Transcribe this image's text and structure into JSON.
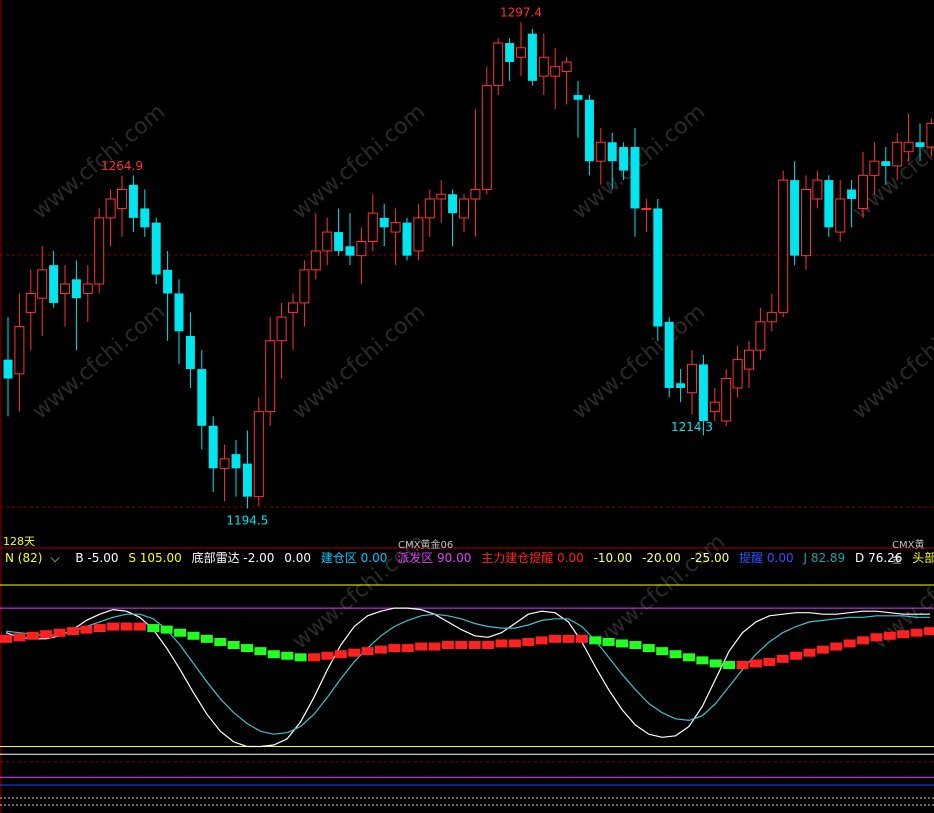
{
  "period_label": "128天",
  "symbol_label": "CMX黄金06",
  "symbol_label_right": "CMX黄金",
  "watermark": "www.cfchi.com",
  "colors": {
    "up": "#ff3333",
    "down": "#00e5ee",
    "dash": "#8b0000",
    "yellow": "#ffff00",
    "magenta": "#e040fb",
    "white": "#ffffff",
    "cyan": "#40c0d0",
    "blue": "#2040ff"
  },
  "indicator_bar": {
    "n": "N (82)",
    "n_arrow": "⌵",
    "b": "B -5.00",
    "s": "S 105.00",
    "bottom_radar": "底部雷达 -2.00",
    "zero": "0.00",
    "build_zone": "建仓区 0.00",
    "distribute_zone": "派发区 90.00",
    "main_alert": "主力建仓提醒 0.00",
    "m10": "-10.00",
    "m20": "-20.00",
    "m25": "-25.00",
    "alert": "提醒 0.00",
    "j": "J 82.89",
    "d": "D 76.26",
    "head": "头部线上取款"
  },
  "chart_data": [
    {
      "type": "candlestick",
      "title": "CMX黄金06",
      "price_annotations": [
        {
          "label": "1297.4",
          "type": "high"
        },
        {
          "label": "1264.9",
          "type": "high"
        },
        {
          "label": "1194.5",
          "type": "low"
        },
        {
          "label": "1214.3",
          "type": "low"
        }
      ],
      "price_range": [
        1191,
        1300
      ],
      "candles": [
        {
          "o": 1226.0,
          "h": 1235.0,
          "l": 1214.0,
          "c": 1222.0
        },
        {
          "o": 1223.0,
          "h": 1240.0,
          "l": 1215.0,
          "c": 1233.0
        },
        {
          "o": 1236.0,
          "h": 1245.0,
          "l": 1228.0,
          "c": 1240.0
        },
        {
          "o": 1239.0,
          "h": 1250.0,
          "l": 1231.0,
          "c": 1245.0
        },
        {
          "o": 1246.0,
          "h": 1249.0,
          "l": 1237.0,
          "c": 1238.0
        },
        {
          "o": 1240.0,
          "h": 1246.0,
          "l": 1233.0,
          "c": 1242.0
        },
        {
          "o": 1243.0,
          "h": 1247.0,
          "l": 1228.0,
          "c": 1239.0
        },
        {
          "o": 1240.0,
          "h": 1246.0,
          "l": 1234.0,
          "c": 1242.0
        },
        {
          "o": 1242.0,
          "h": 1258.0,
          "l": 1240.0,
          "c": 1256.0
        },
        {
          "o": 1256.0,
          "h": 1262.0,
          "l": 1250.0,
          "c": 1260.0
        },
        {
          "o": 1258.0,
          "h": 1264.9,
          "l": 1252.0,
          "c": 1262.0
        },
        {
          "o": 1263.0,
          "h": 1265.0,
          "l": 1253.0,
          "c": 1256.0
        },
        {
          "o": 1258.0,
          "h": 1262.0,
          "l": 1252.0,
          "c": 1254.0
        },
        {
          "o": 1255.0,
          "h": 1256.0,
          "l": 1242.0,
          "c": 1244.0
        },
        {
          "o": 1245.0,
          "h": 1249.0,
          "l": 1230.0,
          "c": 1240.0
        },
        {
          "o": 1240.0,
          "h": 1243.0,
          "l": 1225.0,
          "c": 1232.0
        },
        {
          "o": 1231.0,
          "h": 1236.0,
          "l": 1220.0,
          "c": 1224.0
        },
        {
          "o": 1224.0,
          "h": 1228.0,
          "l": 1207.0,
          "c": 1212.0
        },
        {
          "o": 1212.0,
          "h": 1214.0,
          "l": 1198.0,
          "c": 1203.0
        },
        {
          "o": 1203.0,
          "h": 1208.0,
          "l": 1196.0,
          "c": 1205.0
        },
        {
          "o": 1206.0,
          "h": 1209.0,
          "l": 1197.0,
          "c": 1203.0
        },
        {
          "o": 1204.0,
          "h": 1211.0,
          "l": 1194.5,
          "c": 1197.0
        },
        {
          "o": 1197.0,
          "h": 1218.0,
          "l": 1195.0,
          "c": 1215.0
        },
        {
          "o": 1215.0,
          "h": 1235.0,
          "l": 1212.0,
          "c": 1230.0
        },
        {
          "o": 1230.0,
          "h": 1238.0,
          "l": 1222.0,
          "c": 1235.0
        },
        {
          "o": 1236.0,
          "h": 1240.0,
          "l": 1228.0,
          "c": 1238.0
        },
        {
          "o": 1238.0,
          "h": 1247.0,
          "l": 1233.0,
          "c": 1245.0
        },
        {
          "o": 1245.0,
          "h": 1257.0,
          "l": 1243.0,
          "c": 1249.0
        },
        {
          "o": 1249.0,
          "h": 1256.0,
          "l": 1246.0,
          "c": 1253.0
        },
        {
          "o": 1253.0,
          "h": 1258.0,
          "l": 1248.0,
          "c": 1249.0
        },
        {
          "o": 1250.0,
          "h": 1257.0,
          "l": 1246.0,
          "c": 1248.0
        },
        {
          "o": 1248.0,
          "h": 1254.0,
          "l": 1242.0,
          "c": 1251.0
        },
        {
          "o": 1251.0,
          "h": 1261.0,
          "l": 1249.0,
          "c": 1257.0
        },
        {
          "o": 1256.0,
          "h": 1259.0,
          "l": 1250.0,
          "c": 1254.0
        },
        {
          "o": 1253.0,
          "h": 1258.0,
          "l": 1246.0,
          "c": 1255.0
        },
        {
          "o": 1255.0,
          "h": 1256.0,
          "l": 1247.0,
          "c": 1248.0
        },
        {
          "o": 1249.0,
          "h": 1259.0,
          "l": 1247.0,
          "c": 1256.0
        },
        {
          "o": 1256.0,
          "h": 1262.0,
          "l": 1252.0,
          "c": 1260.0
        },
        {
          "o": 1260.0,
          "h": 1264.0,
          "l": 1255.0,
          "c": 1261.0
        },
        {
          "o": 1261.0,
          "h": 1262.0,
          "l": 1250.0,
          "c": 1257.0
        },
        {
          "o": 1256.0,
          "h": 1261.0,
          "l": 1253.0,
          "c": 1260.0
        },
        {
          "o": 1260.0,
          "h": 1279.0,
          "l": 1252.0,
          "c": 1262.0
        },
        {
          "o": 1262.0,
          "h": 1288.0,
          "l": 1261.0,
          "c": 1284.0
        },
        {
          "o": 1284.0,
          "h": 1294.0,
          "l": 1282.0,
          "c": 1293.0
        },
        {
          "o": 1293.0,
          "h": 1294.0,
          "l": 1285.0,
          "c": 1289.0
        },
        {
          "o": 1290.0,
          "h": 1297.4,
          "l": 1286.0,
          "c": 1292.0
        },
        {
          "o": 1295.0,
          "h": 1296.0,
          "l": 1284.0,
          "c": 1285.0
        },
        {
          "o": 1286.0,
          "h": 1295.0,
          "l": 1282.0,
          "c": 1290.0
        },
        {
          "o": 1286.0,
          "h": 1292.0,
          "l": 1279.0,
          "c": 1288.0
        },
        {
          "o": 1287.0,
          "h": 1290.0,
          "l": 1280.0,
          "c": 1289.0
        },
        {
          "o": 1282.0,
          "h": 1285.0,
          "l": 1273.0,
          "c": 1281.0
        },
        {
          "o": 1281.0,
          "h": 1282.0,
          "l": 1265.0,
          "c": 1268.0
        },
        {
          "o": 1268.0,
          "h": 1275.0,
          "l": 1263.0,
          "c": 1272.0
        },
        {
          "o": 1272.0,
          "h": 1274.0,
          "l": 1262.0,
          "c": 1268.0
        },
        {
          "o": 1271.0,
          "h": 1272.0,
          "l": 1264.0,
          "c": 1266.0
        },
        {
          "o": 1271.0,
          "h": 1275.0,
          "l": 1252.0,
          "c": 1258.0
        },
        {
          "o": 1258.0,
          "h": 1260.0,
          "l": 1253.0,
          "c": 1258.0
        },
        {
          "o": 1258.0,
          "h": 1260.0,
          "l": 1230.0,
          "c": 1233.0
        },
        {
          "o": 1234.0,
          "h": 1235.0,
          "l": 1218.0,
          "c": 1220.0
        },
        {
          "o": 1221.0,
          "h": 1224.0,
          "l": 1217.0,
          "c": 1220.0
        },
        {
          "o": 1219.0,
          "h": 1228.0,
          "l": 1214.3,
          "c": 1225.0
        },
        {
          "o": 1225.0,
          "h": 1227.0,
          "l": 1210.0,
          "c": 1213.0
        },
        {
          "o": 1215.0,
          "h": 1220.0,
          "l": 1213.0,
          "c": 1217.0
        },
        {
          "o": 1213.0,
          "h": 1224.0,
          "l": 1212.0,
          "c": 1222.0
        },
        {
          "o": 1220.0,
          "h": 1229.0,
          "l": 1218.0,
          "c": 1226.0
        },
        {
          "o": 1224.0,
          "h": 1230.0,
          "l": 1220.0,
          "c": 1228.0
        },
        {
          "o": 1228.0,
          "h": 1237.0,
          "l": 1226.0,
          "c": 1234.0
        },
        {
          "o": 1234.0,
          "h": 1240.0,
          "l": 1232.0,
          "c": 1236.0
        },
        {
          "o": 1236.0,
          "h": 1266.0,
          "l": 1235.0,
          "c": 1264.0
        },
        {
          "o": 1264.0,
          "h": 1268.0,
          "l": 1246.0,
          "c": 1248.0
        },
        {
          "o": 1248.0,
          "h": 1265.0,
          "l": 1245.0,
          "c": 1262.0
        },
        {
          "o": 1260.0,
          "h": 1266.0,
          "l": 1258.0,
          "c": 1264.0
        },
        {
          "o": 1264.0,
          "h": 1265.0,
          "l": 1252.0,
          "c": 1254.0
        },
        {
          "o": 1253.0,
          "h": 1264.0,
          "l": 1251.0,
          "c": 1260.0
        },
        {
          "o": 1262.0,
          "h": 1264.0,
          "l": 1254.0,
          "c": 1260.0
        },
        {
          "o": 1258.0,
          "h": 1270.0,
          "l": 1256.0,
          "c": 1265.0
        },
        {
          "o": 1265.0,
          "h": 1272.0,
          "l": 1261.0,
          "c": 1268.0
        },
        {
          "o": 1268.0,
          "h": 1271.0,
          "l": 1263.0,
          "c": 1267.0
        },
        {
          "o": 1267.0,
          "h": 1274.0,
          "l": 1264.0,
          "c": 1272.0
        },
        {
          "o": 1270.0,
          "h": 1278.0,
          "l": 1268.0,
          "c": 1272.0
        },
        {
          "o": 1272.0,
          "h": 1276.0,
          "l": 1268.0,
          "c": 1271.0
        },
        {
          "o": 1271.0,
          "h": 1277.0,
          "l": 1269.0,
          "c": 1276.0
        },
        {
          "o": 1276.0,
          "h": 1278.0,
          "l": 1270.0,
          "c": 1273.0
        },
        {
          "o": 1273.0,
          "h": 1286.0,
          "l": 1272.0,
          "c": 1283.0
        }
      ]
    },
    {
      "type": "line",
      "title": "底部雷达",
      "ylim": [
        -25,
        105
      ],
      "reference_lines": [
        {
          "name": "B",
          "value": -5.0
        },
        {
          "name": "S",
          "value": 105.0
        },
        {
          "name": "派发区",
          "value": 90.0
        },
        {
          "name": "建仓区",
          "value": 0.0
        },
        {
          "name": "-10.00",
          "value": -10.0
        },
        {
          "name": "-20.00",
          "value": -20.0
        },
        {
          "name": "-25.00",
          "value": -25.0
        }
      ],
      "series": [
        {
          "name": "J",
          "last": 82.89,
          "values": [
            74,
            71,
            70,
            70,
            72,
            76,
            82,
            86,
            89,
            88,
            84,
            76,
            64,
            50,
            35,
            21,
            10,
            3,
            0,
            0,
            1,
            5,
            16,
            32,
            50,
            66,
            78,
            85,
            88,
            90,
            90,
            89,
            86,
            81,
            76,
            72,
            71,
            74,
            80,
            86,
            88,
            87,
            81,
            68,
            52,
            37,
            24,
            14,
            8,
            6,
            7,
            13,
            26,
            44,
            62,
            74,
            81,
            85,
            86,
            87,
            87,
            86,
            86,
            87,
            88,
            88,
            87,
            86,
            86,
            86
          ]
        },
        {
          "name": "D",
          "last": 76.26,
          "values": [
            75,
            74,
            73,
            72,
            73,
            75,
            78,
            81,
            84,
            86,
            86,
            83,
            76,
            66,
            54,
            42,
            31,
            22,
            15,
            10,
            8,
            9,
            13,
            21,
            32,
            44,
            55,
            64,
            72,
            78,
            82,
            85,
            86,
            85,
            83,
            80,
            78,
            77,
            77,
            79,
            82,
            83,
            83,
            78,
            69,
            58,
            47,
            37,
            28,
            22,
            18,
            17,
            20,
            28,
            39,
            50,
            60,
            68,
            74,
            78,
            81,
            82,
            83,
            84,
            84,
            85,
            85,
            85,
            84,
            84
          ]
        },
        {
          "name": "主力建仓提醒",
          "values": [
            70,
            71,
            72,
            73,
            74,
            75,
            76,
            77,
            78,
            78,
            78,
            77,
            76,
            74,
            72,
            70,
            68,
            66,
            64,
            62,
            60,
            59,
            58,
            58,
            59,
            60,
            61,
            62,
            63,
            64,
            64,
            65,
            65,
            66,
            66,
            66,
            66,
            67,
            67,
            68,
            69,
            70,
            70,
            70,
            69,
            68,
            67,
            66,
            64,
            62,
            60,
            58,
            56,
            54,
            53,
            53,
            54,
            55,
            57,
            59,
            61,
            63,
            65,
            67,
            69,
            71,
            72,
            73,
            74,
            75
          ]
        }
      ]
    }
  ]
}
